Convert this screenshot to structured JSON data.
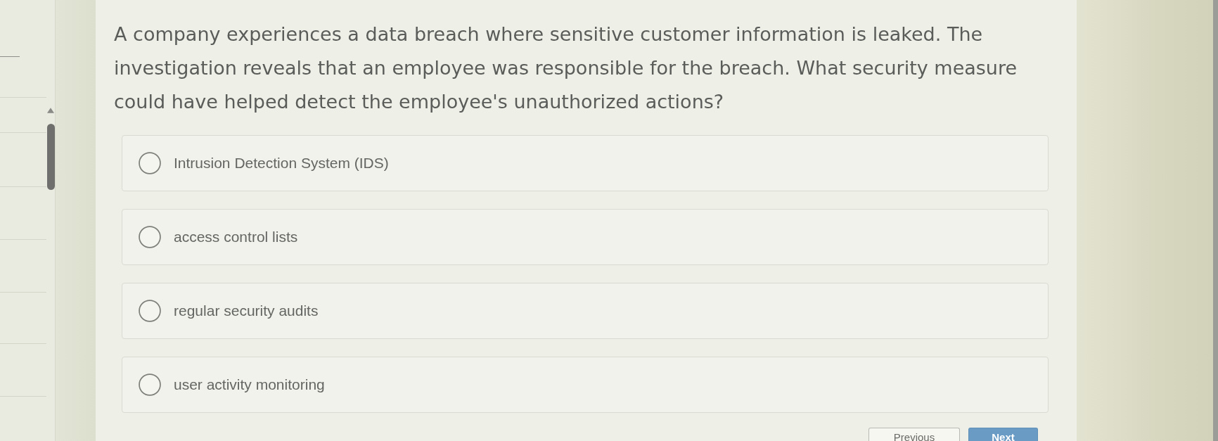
{
  "question": {
    "text": "A company experiences a data breach where sensitive customer information is leaked. The investigation reveals that an employee was responsible for the breach. What security measure could have helped detect the employee's unauthorized actions?"
  },
  "options": [
    {
      "label": "Intrusion Detection System (IDS)",
      "selected": false
    },
    {
      "label": "access control lists",
      "selected": false
    },
    {
      "label": "regular security audits",
      "selected": false
    },
    {
      "label": "user activity monitoring",
      "selected": false
    }
  ],
  "buttons": [
    {
      "label": "Previous",
      "kind": "secondary"
    },
    {
      "label": "Next",
      "kind": "primary"
    }
  ]
}
